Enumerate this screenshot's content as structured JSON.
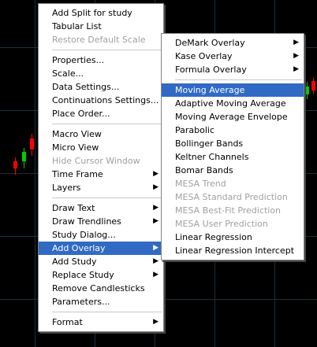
{
  "main_menu": {
    "items": [
      {
        "label": "Add Split for study"
      },
      {
        "label": "Tabular List"
      },
      {
        "label": "Restore Default Scale",
        "disabled": true
      },
      {
        "separator": true
      },
      {
        "label": "Properties..."
      },
      {
        "label": "Scale..."
      },
      {
        "label": "Data Settings..."
      },
      {
        "label": "Continuations Settings..."
      },
      {
        "label": "Place Order..."
      },
      {
        "separator": true
      },
      {
        "label": "Macro View"
      },
      {
        "label": "Micro View"
      },
      {
        "label": "Hide Cursor Window",
        "disabled": true
      },
      {
        "label": "Time Frame",
        "submenu": true
      },
      {
        "label": "Layers",
        "submenu": true
      },
      {
        "separator": true
      },
      {
        "label": "Draw Text",
        "submenu": true
      },
      {
        "label": "Draw Trendlines",
        "submenu": true
      },
      {
        "label": "Study Dialog..."
      },
      {
        "label": "Add Overlay",
        "submenu": true,
        "selected": true
      },
      {
        "label": "Add Study",
        "submenu": true
      },
      {
        "label": "Replace Study",
        "submenu": true
      },
      {
        "label": "Remove Candlesticks"
      },
      {
        "label": "Parameters..."
      },
      {
        "separator": true
      },
      {
        "label": "Format",
        "submenu": true
      }
    ]
  },
  "overlay_submenu": {
    "items": [
      {
        "label": "DeMark Overlay",
        "submenu": true
      },
      {
        "label": "Kase Overlay",
        "submenu": true
      },
      {
        "label": "Formula Overlay",
        "submenu": true
      },
      {
        "separator": true
      },
      {
        "label": "Moving Average",
        "selected": true
      },
      {
        "label": "Adaptive Moving Average"
      },
      {
        "label": "Moving Average Envelope"
      },
      {
        "label": "Parabolic"
      },
      {
        "label": "Bollinger Bands"
      },
      {
        "label": "Keltner Channels"
      },
      {
        "label": "Bomar Bands"
      },
      {
        "label": "MESA Trend",
        "disabled": true
      },
      {
        "label": "MESA Standard Prediction",
        "disabled": true
      },
      {
        "label": "MESA Best-Fit Prediction",
        "disabled": true
      },
      {
        "label": "MESA User Prediction",
        "disabled": true
      },
      {
        "label": "Linear Regression"
      },
      {
        "label": "Linear Regression Intercept"
      }
    ]
  },
  "colors": {
    "background": "#000000",
    "selection": "#316ac5",
    "candle_up": "#00cc00",
    "candle_down": "#ff0000"
  }
}
